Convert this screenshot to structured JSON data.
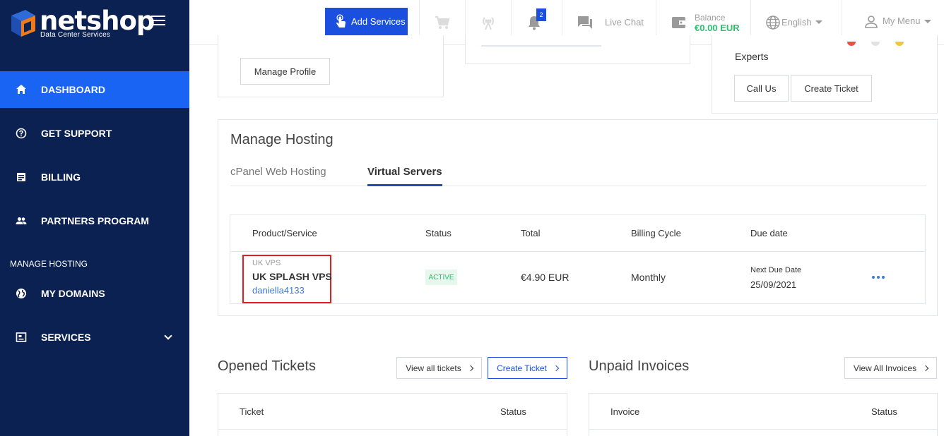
{
  "brand": {
    "name": "netshop",
    "tagline": "Data Center Services"
  },
  "sidebar": {
    "items": [
      {
        "label": "DASHBOARD",
        "icon": "home-icon",
        "active": true
      },
      {
        "label": "GET SUPPORT",
        "icon": "help-icon"
      },
      {
        "label": "BILLING",
        "icon": "billing-icon"
      },
      {
        "label": "PARTNERS PROGRAM",
        "icon": "people-icon"
      }
    ],
    "section_label": "MANAGE HOSTING",
    "hosting_items": [
      {
        "label": "MY DOMAINS",
        "icon": "globe-icon"
      },
      {
        "label": "SERVICES",
        "icon": "services-icon"
      }
    ]
  },
  "topbar": {
    "add_services": "Add Services",
    "notifications_count": "2",
    "live_chat": "Live Chat",
    "balance_label": "Balance",
    "balance_value": "€0.00 EUR",
    "language": "English",
    "my_menu": "My Menu"
  },
  "profile_card": {
    "manage_profile": "Manage Profile"
  },
  "experts_card": {
    "text": "Experts",
    "call_us": "Call Us",
    "create_ticket": "Create Ticket"
  },
  "manage_hosting": {
    "title": "Manage Hosting",
    "tabs": [
      {
        "label": "cPanel Web Hosting",
        "active": false
      },
      {
        "label": "Virtual Servers",
        "active": true
      }
    ],
    "columns": [
      "Product/Service",
      "Status",
      "Total",
      "Billing Cycle",
      "Due date"
    ],
    "rows": [
      {
        "category": "UK VPS",
        "product": "UK SPLASH VPS",
        "username": "daniella4133",
        "status": "ACTIVE",
        "total": "€4.90 EUR",
        "cycle": "Monthly",
        "due_label": "Next Due Date",
        "due_date": "25/09/2021"
      }
    ]
  },
  "tickets": {
    "title": "Opened Tickets",
    "view_all": "View all tickets",
    "create": "Create Ticket",
    "columns": [
      "Ticket",
      "Status"
    ]
  },
  "invoices": {
    "title": "Unpaid Invoices",
    "view_all": "View All Invoices",
    "columns": [
      "Invoice",
      "Status"
    ]
  },
  "colors": {
    "sidebar": "#0b2151",
    "accent": "#1a64f3",
    "button": "#1a4fe0",
    "success": "#2fbf71",
    "highlight": "#e02020"
  }
}
